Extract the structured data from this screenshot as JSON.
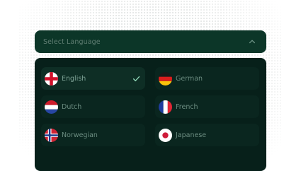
{
  "select": {
    "placeholder": "Select Language",
    "expanded": true,
    "icon": "chevron-up-icon"
  },
  "languages": [
    {
      "label": "English",
      "flag": "flag-england-icon",
      "selected": true
    },
    {
      "label": "German",
      "flag": "flag-germany-icon",
      "selected": false
    },
    {
      "label": "Dutch",
      "flag": "flag-netherlands-icon",
      "selected": false
    },
    {
      "label": "French",
      "flag": "flag-france-icon",
      "selected": false
    },
    {
      "label": "Norwegian",
      "flag": "flag-norway-icon",
      "selected": false
    },
    {
      "label": "Japanese",
      "flag": "flag-japan-icon",
      "selected": false
    }
  ],
  "colors": {
    "trigger_background": "#0c3628",
    "menu_background": "#07201a",
    "text_muted": "#5f7d72",
    "check_accent": "#8fd6b7"
  }
}
